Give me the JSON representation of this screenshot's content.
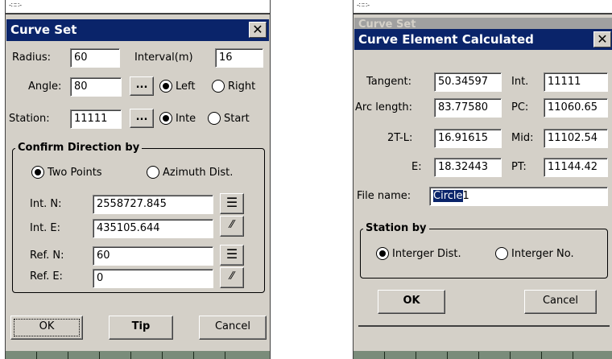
{
  "left": {
    "title": "Curve Set",
    "radius_label": "Radius:",
    "radius_value": "60",
    "interval_label": "Interval(m)",
    "interval_value": "16",
    "angle_label": "Angle:",
    "angle_value": "80",
    "ellipsis": "...",
    "left_label": "Left",
    "right_label": "Right",
    "station_label": "Station:",
    "station_value": "11111",
    "inte_label": "Inte",
    "start_label": "Start",
    "group_title": "Confirm Direction by",
    "two_points": "Two Points",
    "azimuth_dist": "Azimuth Dist.",
    "int_n_label": "Int.  N:",
    "int_n_value": "2558727.845",
    "int_e_label": "Int.  E:",
    "int_e_value": "435105.644",
    "ref_n_label": "Ref.  N:",
    "ref_n_value": "60",
    "ref_e_label": "Ref.  E:",
    "ref_e_value": "0",
    "ok": "OK",
    "tip": "Tip",
    "cancel": "Cancel",
    "selected_direction": "left",
    "selected_station": "inte",
    "selected_confirm": "two-points"
  },
  "right": {
    "background_title": "Curve Set",
    "title": "Curve Element Calculated",
    "tangent_label": "Tangent:",
    "tangent_value": "50.34597",
    "int_label": "Int.",
    "int_value": "11111",
    "arc_label": "Arc length:",
    "arc_value": "83.77580",
    "pc_label": "PC:",
    "pc_value": "11060.65",
    "t2l_label": "2T-L:",
    "t2l_value": "16.91615",
    "mid_label": "Mid:",
    "mid_value": "11102.54",
    "e_label": "E:",
    "e_value": "18.32443",
    "pt_label": "PT:",
    "pt_value": "11144.42",
    "filename_label": "File name:",
    "filename_selected": "Circle",
    "filename_rest": "1",
    "group_title": "Station by",
    "interger_dist": "Interger Dist.",
    "interger_no": "Interger No.",
    "selected_station_by": "interger-dist",
    "ok": "OK",
    "cancel": "Cancel"
  },
  "colors": {
    "title_active": "#0a246a",
    "dialog_face": "#d4d0c8"
  }
}
